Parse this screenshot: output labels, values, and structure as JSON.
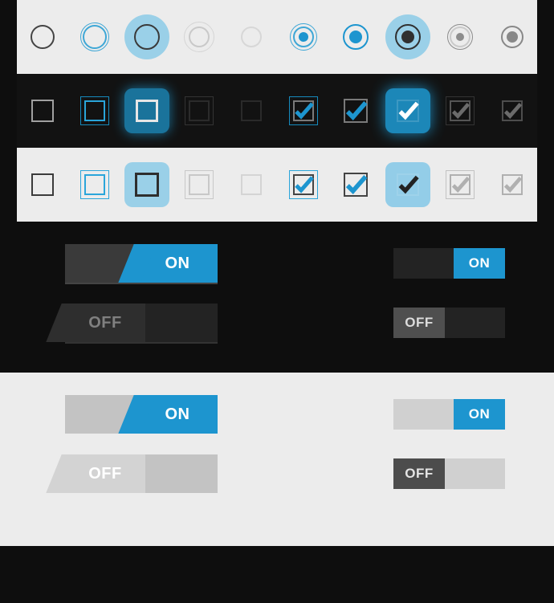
{
  "colors": {
    "accent": "#1d95cf",
    "accent_light": "#58b9e6"
  },
  "toggles": {
    "on_label": "ON",
    "off_label": "OFF"
  },
  "radio_row": {
    "count": 10
  },
  "checkbox_dark_row": {
    "count": 10
  },
  "checkbox_light_row": {
    "count": 10
  }
}
